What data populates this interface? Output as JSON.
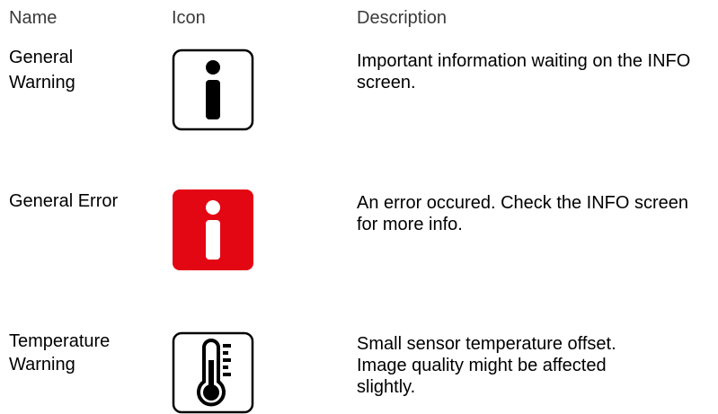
{
  "header": {
    "name": "Name",
    "icon": "Icon",
    "description": "Description"
  },
  "rows": [
    {
      "name": "General Warning",
      "icon": "info-icon-outline",
      "icon_color": "#000000",
      "description": "Important information waiting on the INFO screen."
    },
    {
      "name": "General Error",
      "icon": "info-icon-filled-red",
      "icon_color": "#e30613",
      "description": "An error occured. Check the INFO screen for more info."
    },
    {
      "name": "Temperature Warning",
      "icon": "thermometer-icon-outline",
      "icon_color": "#000000",
      "description": "Small sensor temperature offset. Image quality might be affected slightly."
    }
  ]
}
